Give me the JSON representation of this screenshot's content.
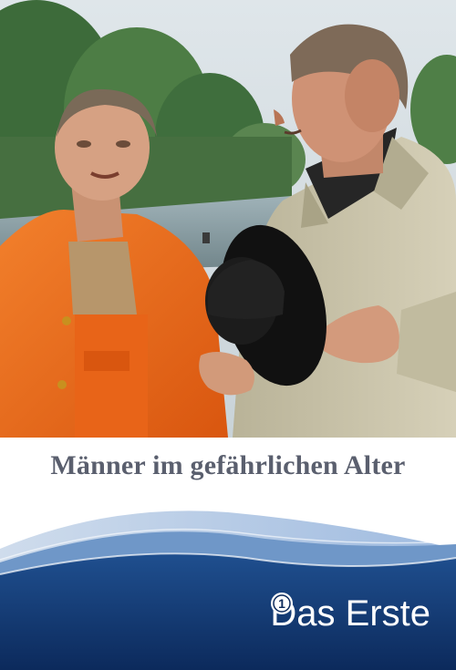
{
  "poster": {
    "title": "Männer im gefährlichen Alter",
    "photo_alt": "",
    "channel": {
      "name": "Das Erste",
      "logo_icon": "ard-one-logo-icon",
      "mark_text": "1"
    }
  },
  "colors": {
    "title_text": "#5a5f6e",
    "wave_dark": "#0c2a5c",
    "wave_mid": "#1f4f8f",
    "wave_light": "#7fa7d6",
    "jacket_orange": "#ee6a17",
    "coat_beige": "#c8c2a9"
  }
}
